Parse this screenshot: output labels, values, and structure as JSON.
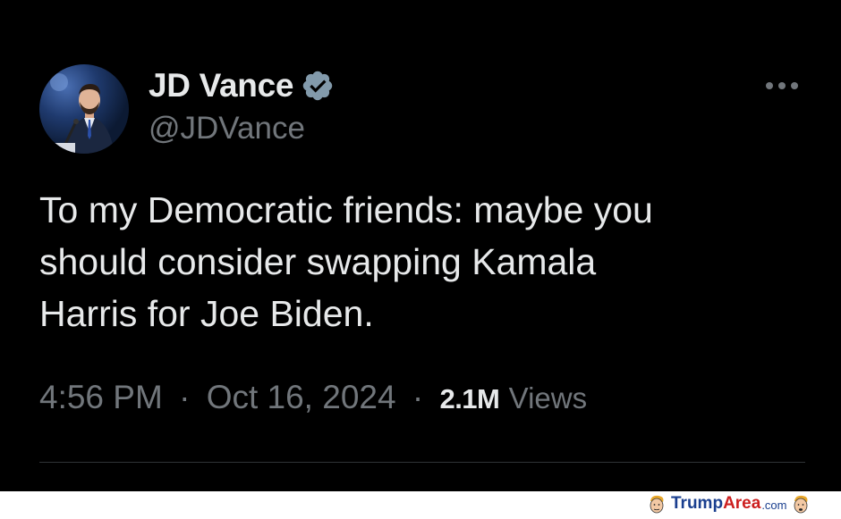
{
  "tweet": {
    "author": {
      "display_name": "JD Vance",
      "handle": "@JDVance",
      "verified": true,
      "avatar": "profile-photo"
    },
    "text": "To my Democratic friends: maybe you\nshould consider swapping Kamala\nHarris for Joe Biden.",
    "time": "4:56 PM",
    "date": "Oct 16, 2024",
    "separator": "·",
    "views_count": "2.1M",
    "views_label": "Views",
    "more_icon": "more-horizontal-icon"
  },
  "watermark": {
    "brand_part1": "Trump",
    "brand_part2": "Area",
    "domain_suffix": ".com"
  },
  "colors": {
    "background": "#000000",
    "primary_text": "#e7e9ea",
    "secondary_text": "#71767b",
    "verified_badge": "#829aab",
    "divider": "#2f3336"
  }
}
